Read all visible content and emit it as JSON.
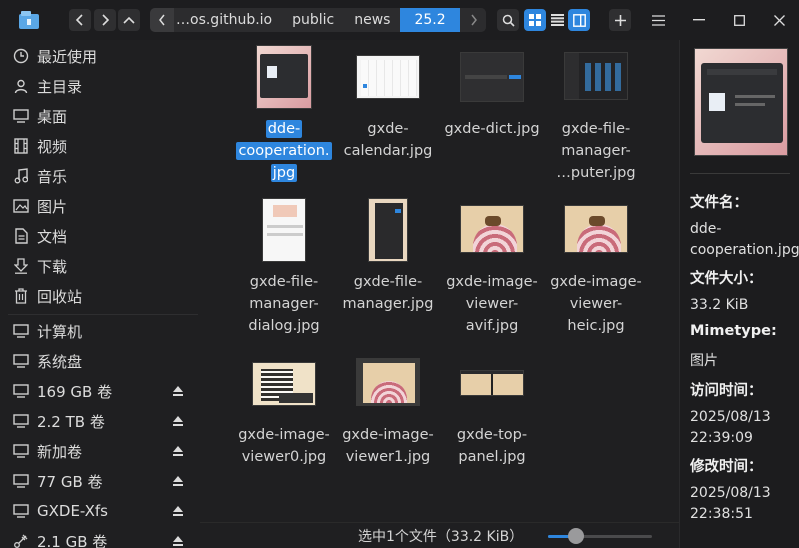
{
  "titlebar": {
    "breadcrumbs": [
      "…os.github.io",
      "public",
      "news",
      "25.2"
    ],
    "active_crumb": "25.2"
  },
  "sidebar": {
    "items": [
      {
        "label": "最近使用",
        "icon": "clock-icon"
      },
      {
        "label": "主目录",
        "icon": "home-icon"
      },
      {
        "label": "桌面",
        "icon": "desktop-icon"
      },
      {
        "label": "视频",
        "icon": "video-icon"
      },
      {
        "label": "音乐",
        "icon": "music-icon"
      },
      {
        "label": "图片",
        "icon": "picture-icon"
      },
      {
        "label": "文档",
        "icon": "document-icon"
      },
      {
        "label": "下载",
        "icon": "download-icon"
      },
      {
        "label": "回收站",
        "icon": "trash-icon"
      }
    ],
    "devices": [
      {
        "label": "计算机",
        "icon": "computer-icon",
        "eject": false
      },
      {
        "label": "系统盘",
        "icon": "drive-icon",
        "eject": false
      },
      {
        "label": "169 GB 卷",
        "icon": "drive-icon",
        "eject": true
      },
      {
        "label": "2.2 TB 卷",
        "icon": "drive-icon",
        "eject": true
      },
      {
        "label": "新加卷",
        "icon": "drive-icon",
        "eject": true
      },
      {
        "label": "77 GB 卷",
        "icon": "drive-icon",
        "eject": true
      },
      {
        "label": "GXDE-Xfs",
        "icon": "drive-icon",
        "eject": true
      },
      {
        "label": "2.1 GB 卷",
        "icon": "usb-icon",
        "eject": true
      }
    ]
  },
  "files": [
    {
      "lines": [
        "dde-",
        "cooperation.",
        "jpg"
      ],
      "selected": true
    },
    {
      "lines": [
        "gxde-",
        "calendar.jpg"
      ],
      "selected": false
    },
    {
      "lines": [
        "gxde-dict.jpg"
      ],
      "selected": false
    },
    {
      "lines": [
        "gxde-file-",
        "manager-",
        "…puter.jpg"
      ],
      "selected": false
    },
    {
      "lines": [
        "gxde-file-",
        "manager-",
        "dialog.jpg"
      ],
      "selected": false
    },
    {
      "lines": [
        "gxde-file-",
        "manager.jpg"
      ],
      "selected": false
    },
    {
      "lines": [
        "gxde-image-",
        "viewer-",
        "avif.jpg"
      ],
      "selected": false
    },
    {
      "lines": [
        "gxde-image-",
        "viewer-",
        "heic.jpg"
      ],
      "selected": false
    },
    {
      "lines": [
        "gxde-image-",
        "viewer0.jpg"
      ],
      "selected": false
    },
    {
      "lines": [
        "gxde-image-",
        "viewer1.jpg"
      ],
      "selected": false
    },
    {
      "lines": [
        "gxde-top-",
        "panel.jpg"
      ],
      "selected": false
    }
  ],
  "status": {
    "text": "选中1个文件（33.2 KiB）",
    "zoom_fraction": 0.27
  },
  "detail": {
    "name_label": "文件名：",
    "name_value_1": "dde-",
    "name_value_2": "cooperation.jpg",
    "size_label": "文件大小：",
    "size_value": "33.2 KiB",
    "mime_label": "Mimetype:",
    "mime_value": "图片",
    "access_label": "访问时间：",
    "access_date": "2025/08/13",
    "access_time": "22:39:09",
    "modify_label": "修改时间：",
    "modify_date": "2025/08/13",
    "modify_time": "22:38:51"
  },
  "colors": {
    "accent": "#2e86de",
    "background": "#1f1f21"
  }
}
